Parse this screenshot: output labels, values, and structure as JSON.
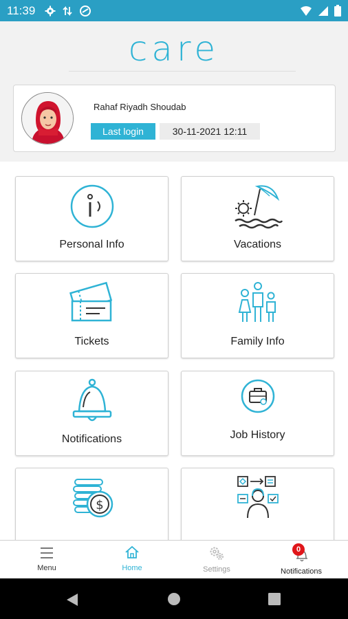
{
  "status_bar": {
    "time": "11:39",
    "icons_left": [
      "gear-icon",
      "data-transfer-icon",
      "vpn-icon"
    ],
    "icons_right": [
      "wifi-icon",
      "signal-icon",
      "battery-icon"
    ]
  },
  "header": {
    "logo_text": "care",
    "accent_color": "#2fb3d5"
  },
  "profile": {
    "name": "Rahaf Riyadh Shoudab",
    "last_login_label": "Last login",
    "last_login_value": "30-11-2021 12:11"
  },
  "tiles": [
    {
      "label": "Personal Info",
      "icon": "info-icon"
    },
    {
      "label": "Vacations",
      "icon": "beach-umbrella-icon"
    },
    {
      "label": "Tickets",
      "icon": "tickets-icon"
    },
    {
      "label": "Family Info",
      "icon": "family-icon"
    },
    {
      "label": "Notifications",
      "icon": "bell-icon"
    },
    {
      "label": "Job History",
      "icon": "briefcase-icon"
    },
    {
      "label": "",
      "icon": "coins-dollar-icon"
    },
    {
      "label": "",
      "icon": "workflow-person-icon"
    }
  ],
  "bottom_nav": {
    "items": [
      {
        "label": "Menu",
        "icon": "hamburger-icon"
      },
      {
        "label": "Home",
        "icon": "home-icon"
      },
      {
        "label": "Settings",
        "icon": "gears-icon"
      },
      {
        "label": "Notifications",
        "icon": "bell-icon",
        "badge": "0"
      }
    ],
    "active_color": "#2fb3d5",
    "badge_color": "#e0161a"
  }
}
